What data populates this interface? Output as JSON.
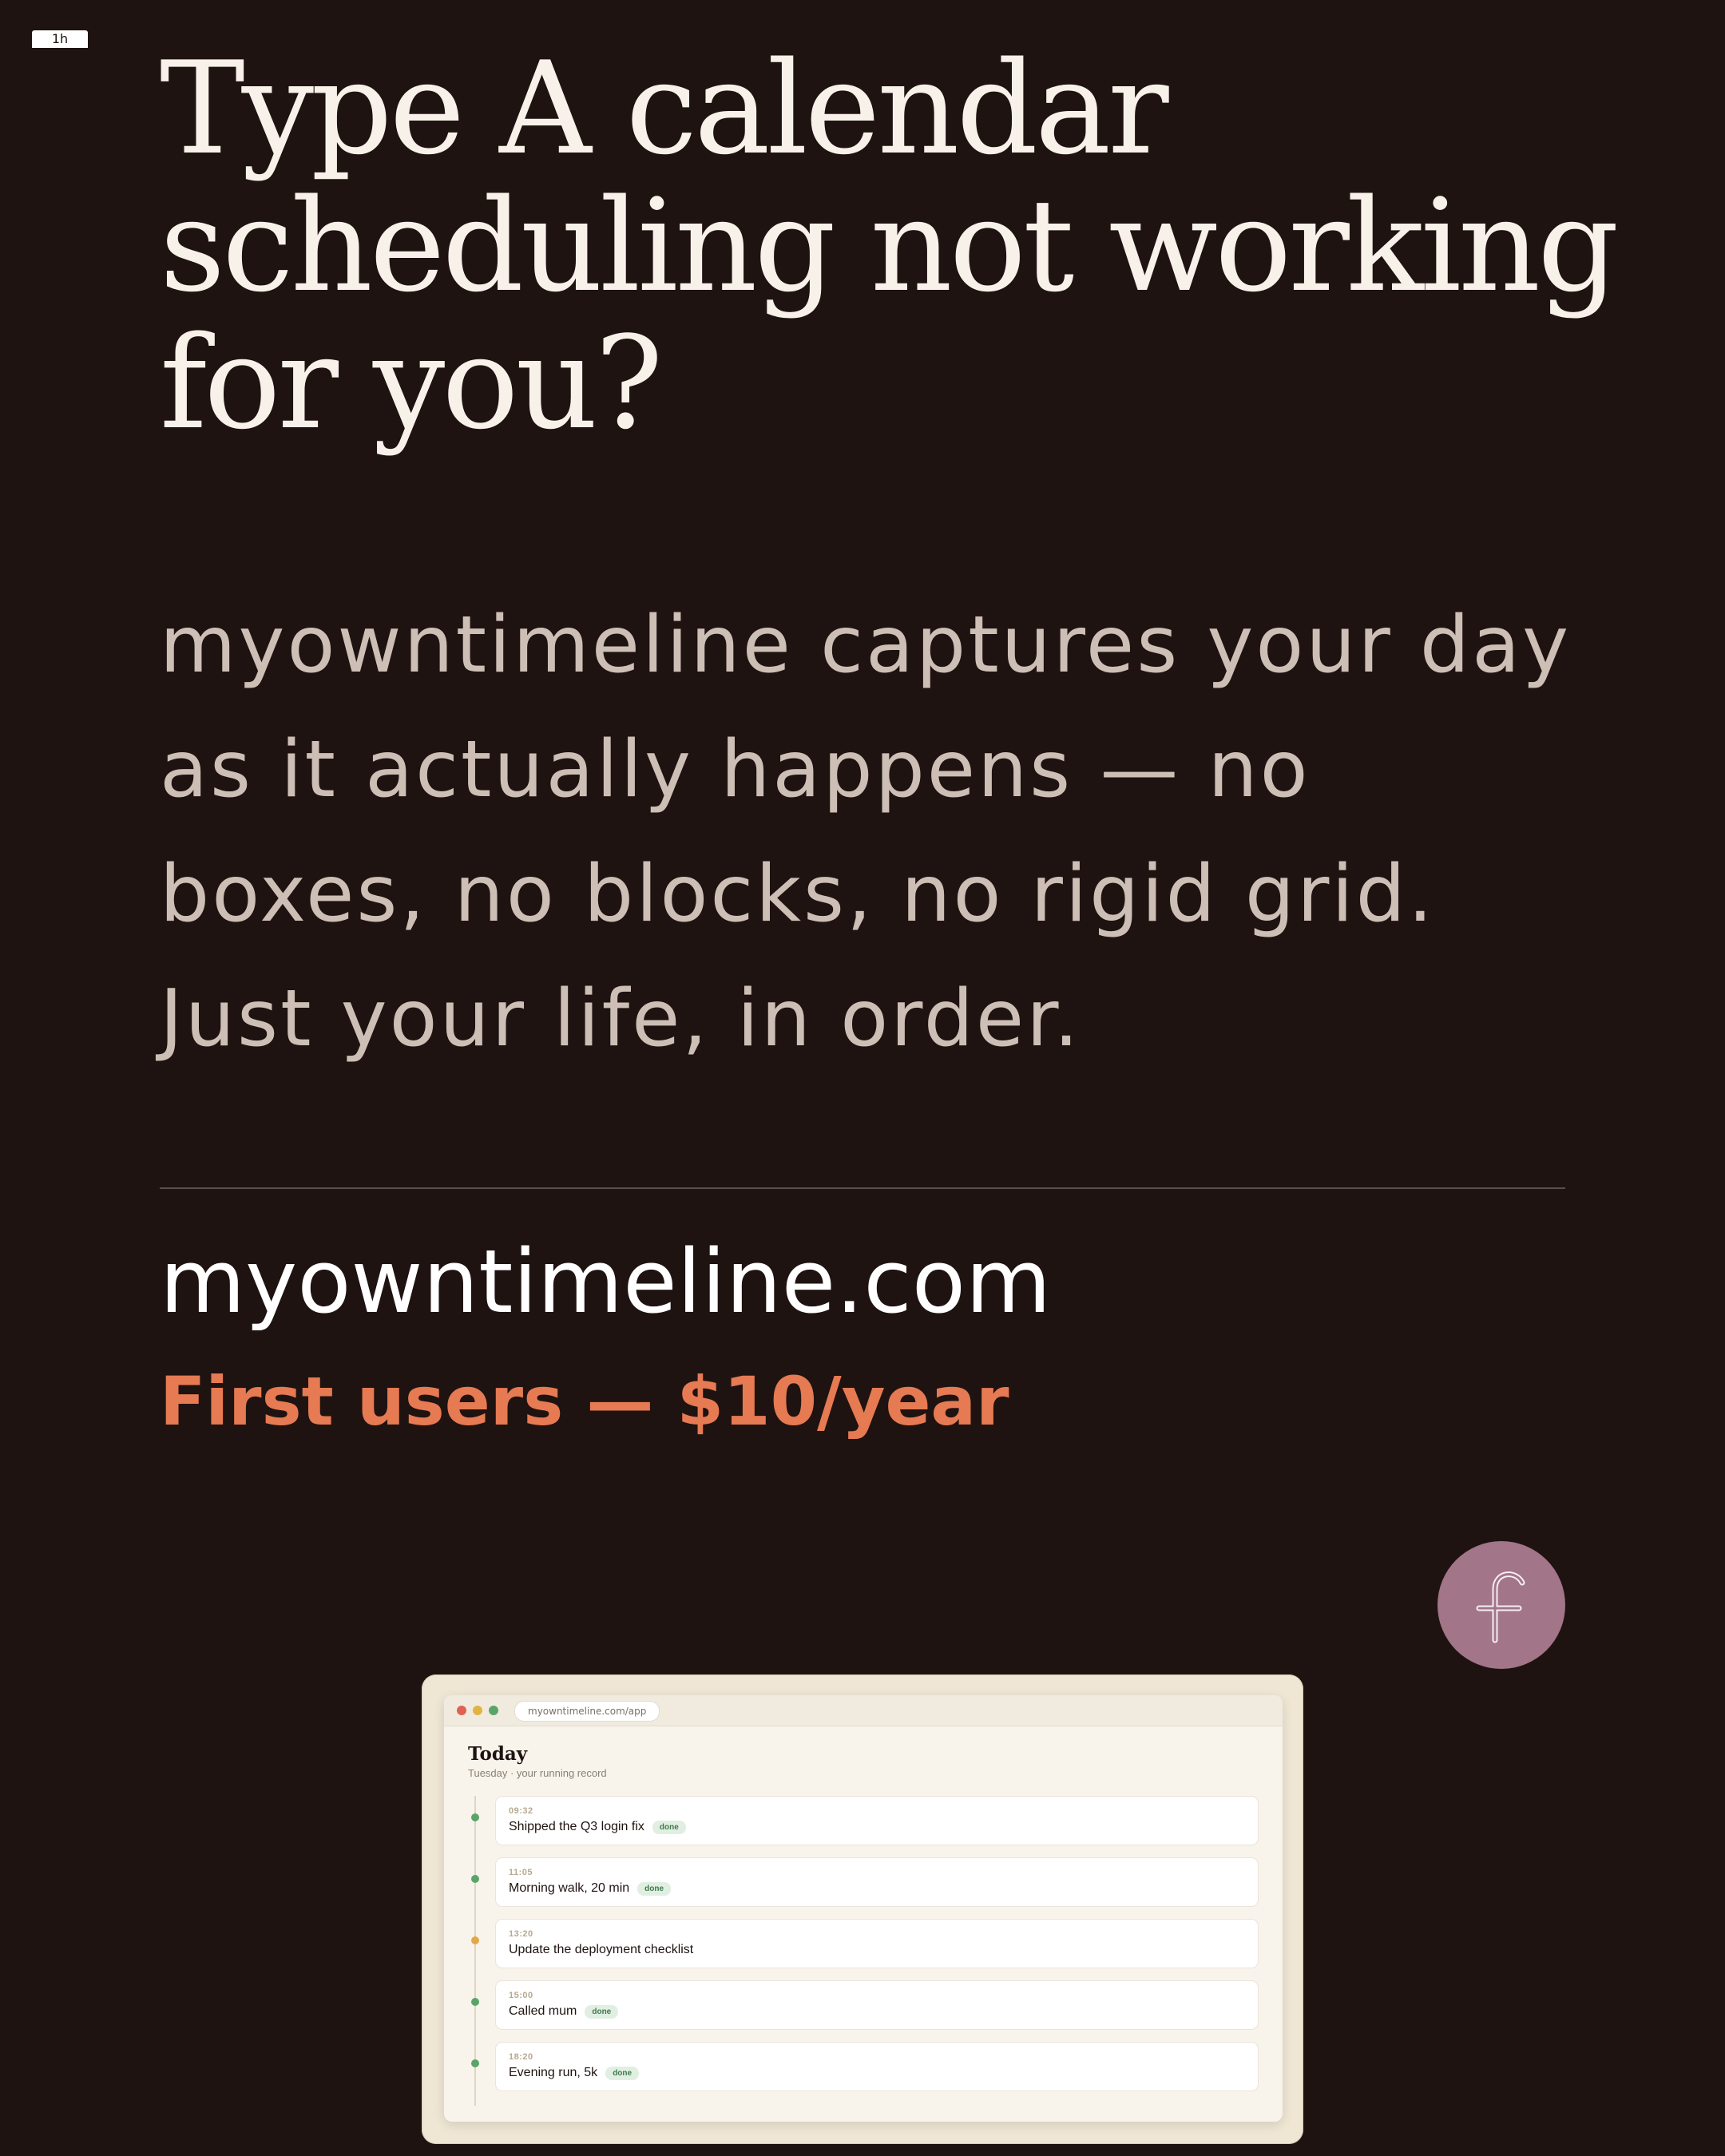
{
  "corner_tab": {
    "label": "1h"
  },
  "headline": {
    "lines": [
      "Type A calendar",
      "scheduling not working",
      "for you?"
    ]
  },
  "body": {
    "lines": [
      "myowntimeline captures your day",
      "as it actually happens — no",
      "boxes, no blocks, no rigid grid.",
      "Just your life, in order."
    ]
  },
  "footer": {
    "domain": "myowntimeline.com",
    "offer": "First users — $10/year"
  },
  "avatar": {
    "icon": "script-f-icon",
    "color": "#a27588"
  },
  "colors": {
    "background": "#1f1311",
    "headline": "#f8f1ea",
    "body": "#cdbfb6",
    "accent": "#e67a52"
  },
  "app_preview": {
    "url": "myowntimeline.com/app",
    "title": "Today",
    "subtitle": "Tuesday · your running record",
    "entries": [
      {
        "time": "09:32",
        "label": "Shipped the Q3 login fix",
        "badge": "done",
        "status_color": "#5aa46a"
      },
      {
        "time": "11:05",
        "label": "Morning walk, 20 min",
        "badge": "done",
        "status_color": "#5aa46a"
      },
      {
        "time": "13:20",
        "label": "Update the deployment checklist",
        "badge": "",
        "status_color": "#e3a84a"
      },
      {
        "time": "15:00",
        "label": "Called mum",
        "badge": "done",
        "status_color": "#5aa46a"
      },
      {
        "time": "18:20",
        "label": "Evening run, 5k",
        "badge": "done",
        "status_color": "#5aa46a"
      }
    ]
  }
}
